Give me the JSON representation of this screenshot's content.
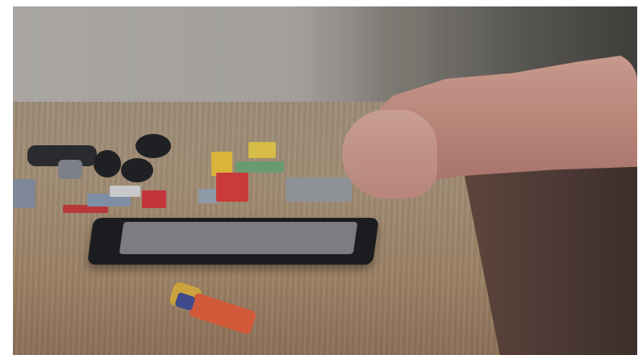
{
  "image": {
    "description_elements": [
      "desk",
      "phone",
      "toy-bricks",
      "hand",
      "small-toy-car"
    ],
    "colors": {
      "desk": "#9c8463",
      "phone": "#1b1c1f",
      "skin": "#c49286",
      "background_wall": "#a9a6a1"
    }
  }
}
